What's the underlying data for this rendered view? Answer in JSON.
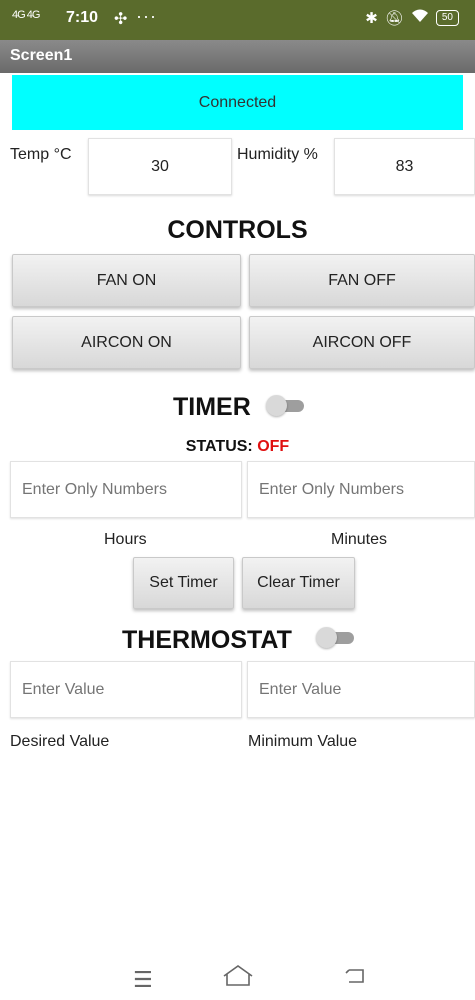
{
  "status_bar": {
    "signal_text": "4G 4G",
    "time": "7:10",
    "extra_icon": "fan-icon",
    "more": "···",
    "battery": "50",
    "icons": [
      "bluetooth-icon",
      "mute-icon",
      "wifi-icon",
      "battery-icon"
    ]
  },
  "title_bar": {
    "title": "Screen1"
  },
  "connection": {
    "status": "Connected",
    "color": "#00ffff"
  },
  "readings": {
    "temp_label": "Temp °C",
    "temp_value": "30",
    "humidity_label": "Humidity %",
    "humidity_value": "83"
  },
  "controls": {
    "heading": "CONTROLS",
    "fan_on": "FAN ON",
    "fan_off": "FAN OFF",
    "aircon_on": "AIRCON ON",
    "aircon_off": "AIRCON OFF"
  },
  "timer": {
    "heading": "TIMER",
    "toggle_on": false,
    "status_label": "STATUS:",
    "status_value": "OFF",
    "status_color": "#e01010",
    "hours_placeholder": "Enter Only Numbers",
    "minutes_placeholder": "Enter Only Numbers",
    "hours_label": "Hours",
    "minutes_label": "Minutes",
    "set_button": "Set Timer",
    "clear_button": "Clear Timer"
  },
  "thermostat": {
    "heading": "THERMOSTAT",
    "toggle_on": false,
    "desired_placeholder": "Enter Value",
    "minimum_placeholder": "Enter Value",
    "desired_label": "Desired Value",
    "minimum_label": "Minimum Value"
  },
  "nav_bar": {
    "icons": [
      "menu-icon",
      "home-icon",
      "back-icon"
    ]
  }
}
